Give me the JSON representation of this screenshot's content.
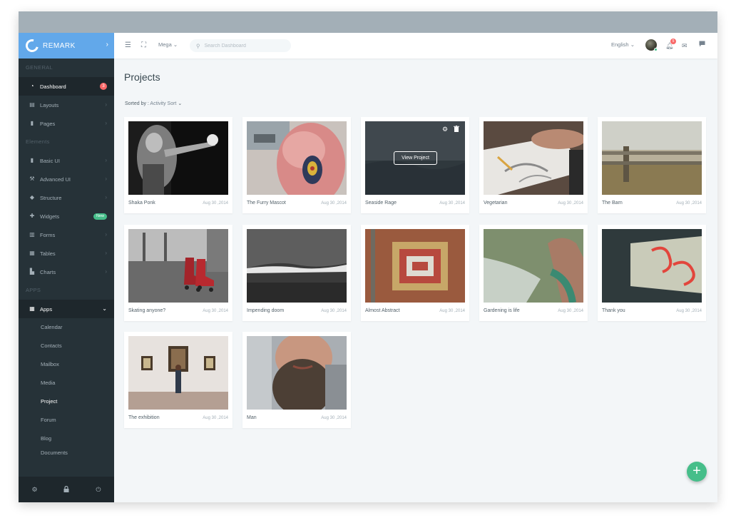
{
  "brand": {
    "name": "REMARK"
  },
  "sidebar": {
    "sections": {
      "general": "GENERAL",
      "elements": "Elements",
      "apps": "APPS"
    },
    "general_items": [
      {
        "label": "Dashboard",
        "icon": "dashboard-icon",
        "badge": "3"
      },
      {
        "label": "Layouts",
        "icon": "layout-icon"
      },
      {
        "label": "Pages",
        "icon": "page-icon"
      }
    ],
    "element_items": [
      {
        "label": "Basic UI",
        "icon": "bookmark-icon"
      },
      {
        "label": "Advanced UI",
        "icon": "wrench-icon"
      },
      {
        "label": "Structure",
        "icon": "puzzle-icon"
      },
      {
        "label": "Widgets",
        "icon": "widget-icon",
        "badge": "New"
      },
      {
        "label": "Forms",
        "icon": "form-icon"
      },
      {
        "label": "Tables",
        "icon": "table-icon"
      },
      {
        "label": "Charts",
        "icon": "chart-icon"
      }
    ],
    "apps_item": {
      "label": "Apps",
      "icon": "grid-icon"
    },
    "apps_sub": [
      "Calendar",
      "Contacts",
      "Mailbox",
      "Media",
      "Project",
      "Forum",
      "Blog",
      "Documents"
    ],
    "current_sub": "Project"
  },
  "topbar": {
    "mega": "Mega",
    "search_placeholder": "Search Dashboard",
    "language": "English",
    "notification_count": "5"
  },
  "page": {
    "title": "Projects",
    "sort_label": "Sorted by : ",
    "sort_value": "Activity Sort"
  },
  "projects": [
    {
      "title": "Shaka Ponk",
      "date": "Aug 30 ,2014"
    },
    {
      "title": "The Furry Mascot",
      "date": "Aug 30 ,2014"
    },
    {
      "title": "Seaside Rage",
      "date": "Aug 30 ,2014",
      "hover_button": "View Project"
    },
    {
      "title": "Vegetarian",
      "date": "Aug 30 ,2014"
    },
    {
      "title": "The Barn",
      "date": "Aug 30 ,2014"
    },
    {
      "title": "Skating anyone?",
      "date": "Aug 30 ,2014"
    },
    {
      "title": "Impending doom",
      "date": "Aug 30 ,2014"
    },
    {
      "title": "Almost Abstract",
      "date": "Aug 30 ,2014"
    },
    {
      "title": "Gardening is life",
      "date": "Aug 30 ,2014"
    },
    {
      "title": "Thank you",
      "date": "Aug 30 ,2014"
    },
    {
      "title": "The exhibition",
      "date": "Aug 30 ,2014"
    },
    {
      "title": "Man",
      "date": "Aug 30 ,2014"
    }
  ],
  "colors": {
    "brand": "#62a8ea",
    "sidebar": "#263238",
    "success": "#46be8a",
    "danger": "#f96868"
  }
}
